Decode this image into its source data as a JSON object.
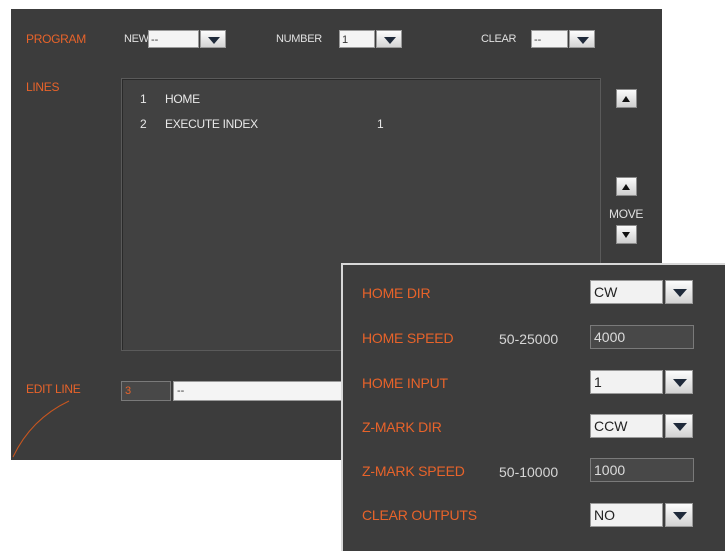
{
  "program": {
    "label": "PROGRAM",
    "new_label": "NEW",
    "new_value": "--",
    "number_label": "NUMBER",
    "number_value": "1",
    "clear_label": "CLEAR",
    "clear_value": "--"
  },
  "lines": {
    "label": "LINES",
    "rows": [
      {
        "num": "1",
        "cmd": "HOME",
        "arg": ""
      },
      {
        "num": "2",
        "cmd": "EXECUTE INDEX",
        "arg": "1"
      }
    ],
    "move_label": "MOVE"
  },
  "edit_line": {
    "label": "EDIT LINE",
    "number": "3",
    "value": "--"
  },
  "home_settings": {
    "home_dir": {
      "label": "HOME DIR",
      "value": "CW"
    },
    "home_speed": {
      "label": "HOME SPEED",
      "range": "50-25000",
      "value": "4000"
    },
    "home_input": {
      "label": "HOME INPUT",
      "value": "1"
    },
    "zmark_dir": {
      "label": "Z-MARK DIR",
      "value": "CCW"
    },
    "zmark_speed": {
      "label": "Z-MARK SPEED",
      "range": "50-10000",
      "value": "1000"
    },
    "clear_outputs": {
      "label": "CLEAR OUTPUTS",
      "value": "NO"
    }
  },
  "colors": {
    "panel_bg": "#3c3c3c",
    "accent_orange": "#e8632a"
  }
}
